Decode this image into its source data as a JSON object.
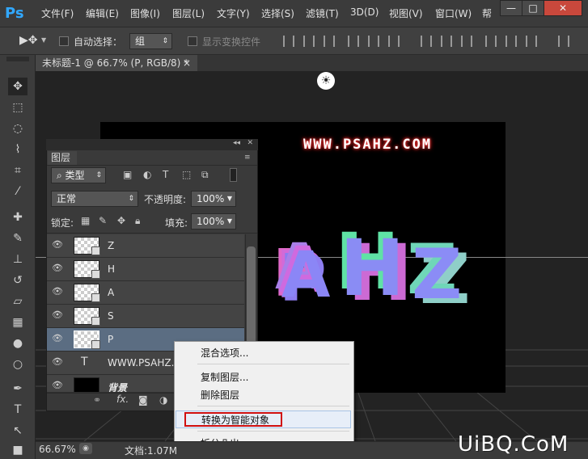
{
  "app": {
    "logo": "Ps"
  },
  "menu": [
    "文件(F)",
    "编辑(E)",
    "图像(I)",
    "图层(L)",
    "文字(Y)",
    "选择(S)",
    "滤镜(T)",
    "3D(D)",
    "视图(V)",
    "窗口(W)",
    "帮"
  ],
  "window_controls": {
    "minimize": "—",
    "maximize": "□",
    "close": "✕"
  },
  "options_bar": {
    "auto_select_label": "自动选择：",
    "auto_select_value": "组",
    "show_transform_label": "显示变换控件"
  },
  "document_tab": {
    "title": "未标题-1 @ 66.7% (P, RGB/8) *",
    "close": "×"
  },
  "canvas": {
    "text": "WWW.PSAHZ.COM",
    "letters": [
      "P",
      "A",
      "H",
      "Z"
    ]
  },
  "layers_panel": {
    "tab_label": "图层",
    "filter_label": "类型",
    "blend_mode": "正常",
    "opacity_label": "不透明度:",
    "opacity_value": "100%",
    "lock_label": "锁定:",
    "fill_label": "填充:",
    "fill_value": "100%",
    "layers": [
      {
        "name": "Z",
        "type": "smart",
        "visible": true,
        "selected": false
      },
      {
        "name": "H",
        "type": "smart",
        "visible": true,
        "selected": false
      },
      {
        "name": "A",
        "type": "smart",
        "visible": true,
        "selected": false
      },
      {
        "name": "S",
        "type": "smart",
        "visible": true,
        "selected": false
      },
      {
        "name": "P",
        "type": "smart",
        "visible": true,
        "selected": true
      },
      {
        "name": "WWW.PSAHZ.CO",
        "type": "text",
        "visible": true,
        "selected": false
      },
      {
        "name": "背景",
        "type": "background",
        "visible": true,
        "selected": false
      }
    ],
    "bottom_icons": [
      "link-icon",
      "fx-icon",
      "mask-icon",
      "adjustment-icon"
    ]
  },
  "context_menu": {
    "items": [
      "混合选项...",
      "复制图层...",
      "删除图层",
      "转换为智能对象",
      "拆分凸出"
    ],
    "highlighted": "转换为智能对象"
  },
  "status_bar": {
    "zoom": "66.67%",
    "doc_info": "文档:1.07M"
  },
  "watermark": "UiBQ.CoM",
  "colors": {
    "accent": "#31a8ff",
    "highlight_box": "#d01010",
    "selected_layer": "#5b6d82"
  }
}
